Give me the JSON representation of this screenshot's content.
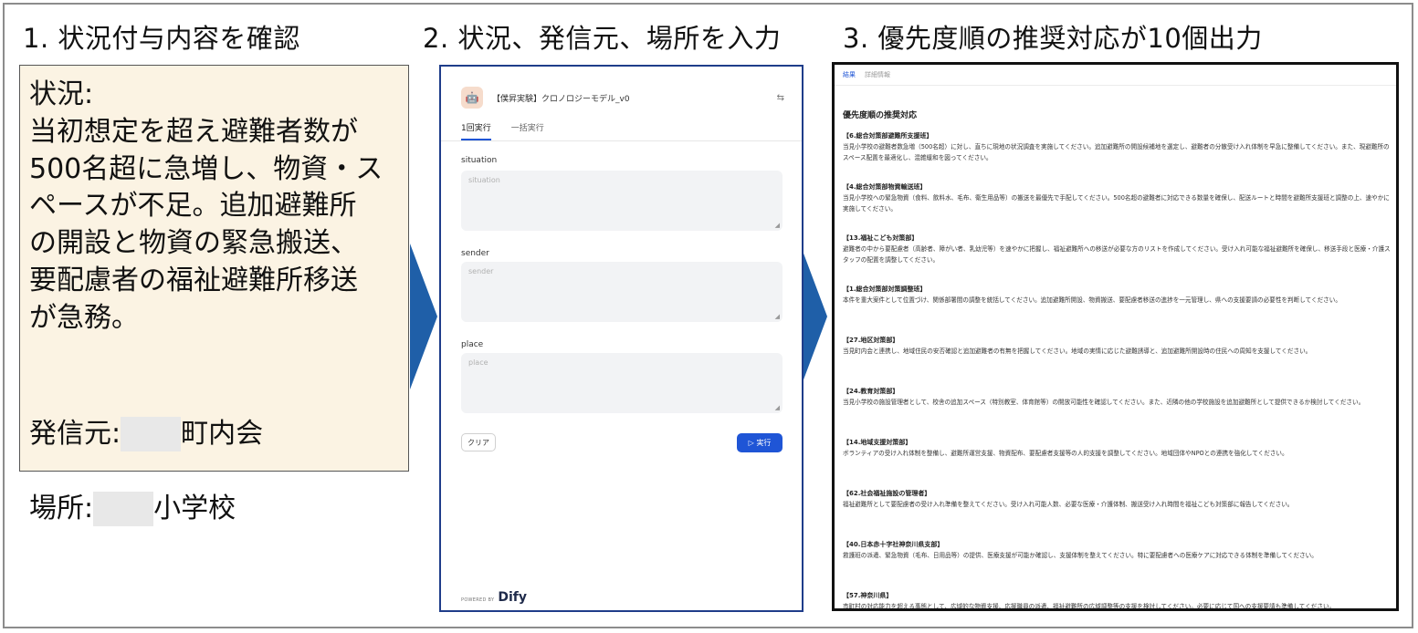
{
  "step_titles": {
    "step1": "1. 状況付与内容を確認",
    "step2": "2. 状況、発信元、場所を入力",
    "step3": "3. 優先度順の推奨対応が10個出力"
  },
  "panel1": {
    "situation_text": "状況:\n当初想定を超え避難者数が\n500名超に急増し、物資・ス\nペースが不足。追加避難所\nの開設と物資の緊急搬送、\n要配慮者の福祉避難所移送\nが急務。",
    "sender_prefix": "発信元:",
    "sender_suffix": "町内会",
    "place_prefix": "場所:",
    "place_suffix": "小学校"
  },
  "app": {
    "avatar_icon": "robot-icon",
    "title": "【僕昇実験】クロノロジーモデル_v0",
    "tabs": [
      "1回実行",
      "一括実行"
    ],
    "fields": [
      {
        "label": "situation",
        "placeholder": "situation"
      },
      {
        "label": "sender",
        "placeholder": "sender"
      },
      {
        "label": "place",
        "placeholder": "place"
      }
    ],
    "clear_label": "クリア",
    "run_label": "▷ 実行",
    "powered_by": "POWERED BY",
    "brand": "Dify"
  },
  "results": {
    "tabs": [
      "結果",
      "詳細情報"
    ],
    "heading": "優先度順の推奨対応",
    "items": [
      {
        "title": "【6.総合対策部避難所支援班】",
        "body": "当見小学校の避難者数急増（500名超）に対し、直ちに現地の状況調査を実施してください。追加避難所の開設候補地を選定し、避難者の分散受け入れ体制を早急に整備してください。また、現避難所のスペース配置を最適化し、混雑緩和を図ってください。"
      },
      {
        "title": "【4.総合対策部物資輸送班】",
        "body": "当見小学校への緊急物資（食料、飲料水、毛布、衛生用品等）の搬送を最優先で手配してください。500名超の避難者に対応できる数量を確保し、配送ルートと時間を避難所支援班と調整の上、速やかに実施してください。"
      },
      {
        "title": "【13.福祉こども対策部】",
        "body": "避難者の中から要配慮者（高齢者、障がい者、乳幼児等）を速やかに把握し、福祉避難所への移送が必要な方のリストを作成してください。受け入れ可能な福祉避難所を確保し、移送手段と医療・介護スタッフの配置を調整してください。"
      },
      {
        "title": "【1.総合対策部対策調整班】",
        "body": "本件を重大案件として位置づけ、関係部署間の調整を統括してください。追加避難所開設、物資搬送、要配慮者移送の進捗を一元管理し、県への支援要請の必要性を判断してください。"
      },
      {
        "title": "【27.地区対策部】",
        "body": "当見町内会と連携し、地域住民の安否確認と追加避難者の有無を把握してください。地域の実情に応じた避難誘導と、追加避難所開設時の住民への周知を支援してください。"
      },
      {
        "title": "【24.教育対策部】",
        "body": "当見小学校の施設管理者として、校舎の追加スペース（特別教室、体育館等）の開放可能性を確認してください。また、近隣の他の学校施設を追加避難所として提供できるか検討してください。"
      },
      {
        "title": "【14.地域支援対策部】",
        "body": "ボランティアの受け入れ体制を整備し、避難所運営支援、物資配布、要配慮者支援等の人的支援を調整してください。地域団体やNPOとの連携を強化してください。"
      },
      {
        "title": "【62.社会福祉施設の管理者】",
        "body": "福祉避難所として要配慮者の受け入れ準備を整えてください。受け入れ可能人数、必要な医療・介護体制、搬送受け入れ時間を福祉こども対策部に報告してください。"
      },
      {
        "title": "【40.日本赤十字社神奈川県支部】",
        "body": "救護班の派遣、緊急物資（毛布、日用品等）の提供、医療支援が可能か確認し、支援体制を整えてください。特に要配慮者への医療ケアに対応できる体制を準備してください。"
      },
      {
        "title": "【57.神奈川県】",
        "body": "市町村の対応能力を超える事態として、広域的な物資支援、応援職員の派遣、福祉避難所の広域調整等の支援を検討してください。必要に応じて国への支援要請も準備してください。"
      }
    ]
  }
}
